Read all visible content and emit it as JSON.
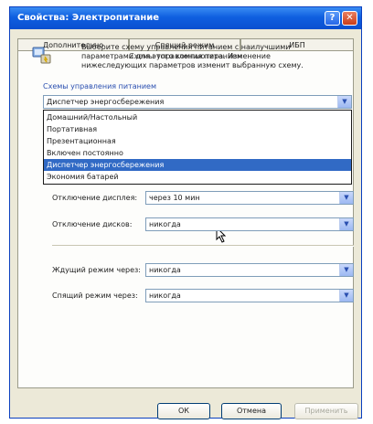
{
  "window": {
    "title": "Свойства: Электропитание",
    "help_label": "?",
    "close_label": "✕",
    "title_bar_color": "#0f5fe0"
  },
  "tabs": [
    {
      "label": "Дополнительно",
      "active": false
    },
    {
      "label": "Спящий режим",
      "active": false
    },
    {
      "label": "ИБП",
      "active": false
    }
  ],
  "panel": {
    "title": "Схемы управления питанием",
    "description": "Выберите схему управления питанием с наилучшими параметрами для этого компьютера. Изменение нижеследующих параметров изменит выбранную схему."
  },
  "schemes": {
    "label": "Схемы управления питанием",
    "selected": "Диспетчер энергосбережения",
    "options": [
      "Домашний/Настольный",
      "Портативная",
      "Презентационная",
      "Включен постоянно",
      "Диспетчер энергосбережения",
      "Экономия батарей"
    ],
    "highlighted_index": 4
  },
  "settings": [
    {
      "label": "Отключение дисплея:",
      "value": "через 10 мин"
    },
    {
      "label": "Отключение дисков:",
      "value": "никогда"
    },
    {
      "label": "Ждущий режим через:",
      "value": "никогда"
    },
    {
      "label": "Спящий режим через:",
      "value": "никогда"
    }
  ],
  "buttons": {
    "ok": "ОК",
    "cancel": "Отмена",
    "apply": "Применить"
  },
  "icons": {
    "info": "power-scheme-icon",
    "cursor": "mouse-pointer-icon"
  },
  "colors": {
    "selection": "#316ac5",
    "accent": "#2a4fb0"
  }
}
